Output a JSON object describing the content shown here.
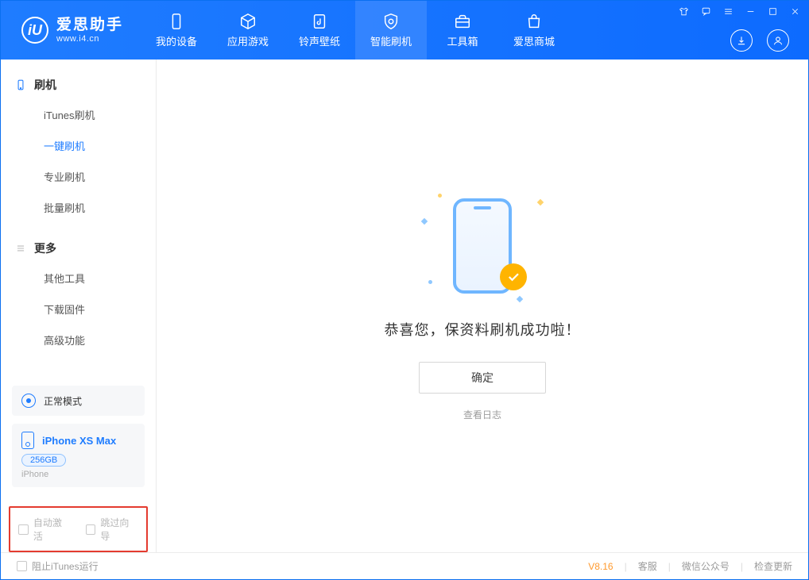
{
  "app": {
    "name_cn": "爱思助手",
    "url": "www.i4.cn"
  },
  "nav": [
    {
      "label": "我的设备"
    },
    {
      "label": "应用游戏"
    },
    {
      "label": "铃声壁纸"
    },
    {
      "label": "智能刷机"
    },
    {
      "label": "工具箱"
    },
    {
      "label": "爱思商城"
    }
  ],
  "sidebar": {
    "group1": {
      "title": "刷机",
      "items": [
        "iTunes刷机",
        "一键刷机",
        "专业刷机",
        "批量刷机"
      ]
    },
    "group2": {
      "title": "更多",
      "items": [
        "其他工具",
        "下载固件",
        "高级功能"
      ]
    },
    "mode_label": "正常模式",
    "device": {
      "name": "iPhone XS Max",
      "storage": "256GB",
      "type": "iPhone"
    },
    "checkbox1": "自动激活",
    "checkbox2": "跳过向导"
  },
  "main": {
    "success_text": "恭喜您，保资料刷机成功啦！",
    "ok_button": "确定",
    "log_link": "查看日志"
  },
  "footer": {
    "block_itunes": "阻止iTunes运行",
    "version": "V8.16",
    "links": [
      "客服",
      "微信公众号",
      "检查更新"
    ]
  }
}
